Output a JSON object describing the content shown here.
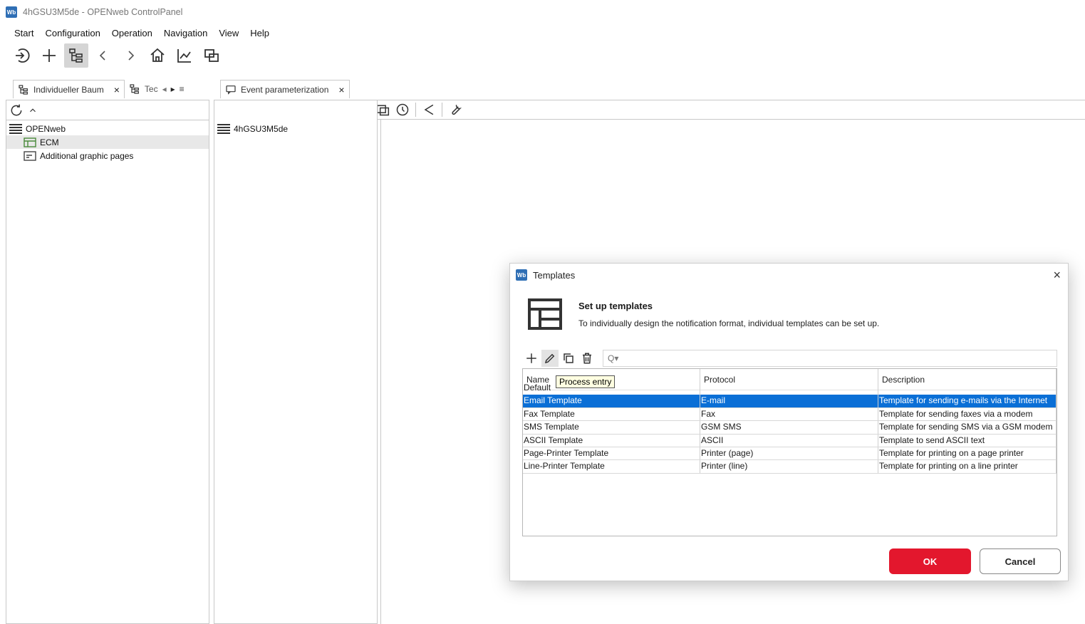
{
  "window": {
    "title": "4hGSU3M5de - OPENweb ControlPanel",
    "app_icon": "Wb"
  },
  "menu": [
    "Start",
    "Configuration",
    "Operation",
    "Navigation",
    "View",
    "Help"
  ],
  "tabs": {
    "left_tab_label": "Individueller Baum",
    "left_tab_close": "×",
    "second_tab_label": "Tec",
    "event_tab_label": "Event parameterization",
    "event_tab_close": "×"
  },
  "tree": {
    "root": "OPENweb",
    "items": [
      "ECM",
      "Additional graphic pages"
    ]
  },
  "middle_pane": {
    "item": "4hGSU3M5de"
  },
  "dialog": {
    "title": "Templates",
    "close": "×",
    "heading": "Set up templates",
    "subheading": "To individually design the notification format, individual templates can be set up.",
    "search_placeholder": "Q▾",
    "tooltip": "Process entry",
    "columns": [
      "Name",
      "Protocol",
      "Description"
    ],
    "default_row": "Default",
    "rows": [
      {
        "name": "Email Template",
        "protocol": "E-mail",
        "description": "Template for sending e-mails via the Internet"
      },
      {
        "name": "Fax Template",
        "protocol": "Fax",
        "description": "Template for sending faxes via a modem"
      },
      {
        "name": "SMS Template",
        "protocol": "GSM SMS",
        "description": "Template for sending SMS via a GSM modem"
      },
      {
        "name": "ASCII Template",
        "protocol": "ASCII",
        "description": "Template to send ASCII text"
      },
      {
        "name": "Page-Printer Template",
        "protocol": "Printer (page)",
        "description": "Template for printing on a page printer"
      },
      {
        "name": "Line-Printer Template",
        "protocol": "Printer (line)",
        "description": "Template for printing on a line printer"
      }
    ],
    "ok_label": "OK",
    "cancel_label": "Cancel",
    "accent_color": "#e3172d",
    "selection_color": "#0a6fd6"
  }
}
